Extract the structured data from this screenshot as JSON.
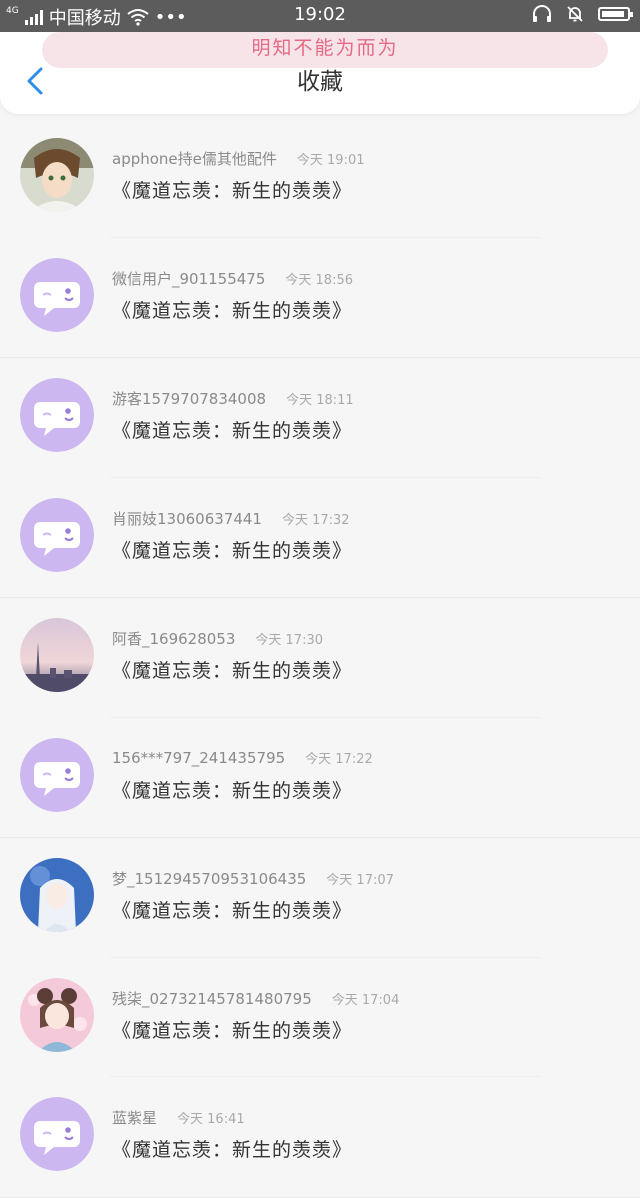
{
  "status_bar": {
    "network": "4G",
    "carrier": "中国移动",
    "more": "•••",
    "time": "19:02",
    "battery_level": 0.9
  },
  "banner": {
    "text": "明知不能为而为"
  },
  "header": {
    "title": "收藏"
  },
  "items": [
    {
      "user": "apphone持e儒其他配件",
      "time": "今天 19:01",
      "book": "《魔道忘羡：新生的羡羡》",
      "avatar": "anime-boy-avatar"
    },
    {
      "user": "微信用户_901155475",
      "time": "今天 18:56",
      "book": "《魔道忘羡：新生的羡羡》",
      "avatar": "default-chat-avatar"
    },
    {
      "user": "游客1579707834008",
      "time": "今天 18:11",
      "book": "《魔道忘羡：新生的羡羡》",
      "avatar": "default-chat-avatar"
    },
    {
      "user": "肖丽妓13060637441",
      "time": "今天 17:32",
      "book": "《魔道忘羡：新生的羡羡》",
      "avatar": "default-chat-avatar"
    },
    {
      "user": "阿香_169628053",
      "time": "今天 17:30",
      "book": "《魔道忘羡：新生的羡羡》",
      "avatar": "city-skyline-avatar"
    },
    {
      "user": "156***797_241435795",
      "time": "今天 17:22",
      "book": "《魔道忘羡：新生的羡羡》",
      "avatar": "default-chat-avatar"
    },
    {
      "user": "梦_1512945709531064​35",
      "time": "今天 17:07",
      "book": "《魔道忘羡：新生的羡羡》",
      "avatar": "anime-white-hair-avatar"
    },
    {
      "user": "残柒_02732145781480795",
      "time": "今天 17:04",
      "book": "《魔道忘羡：新生的羡羡》",
      "avatar": "anime-girl-avatar"
    },
    {
      "user": "蓝紫星",
      "time": "今天 16:41",
      "book": "《魔道忘羡：新生的羡羡》",
      "avatar": "default-chat-avatar"
    }
  ],
  "colors": {
    "accent_blue": "#2c8fe8",
    "default_avatar": "#cdb7f0",
    "banner_text": "#e56a85"
  }
}
